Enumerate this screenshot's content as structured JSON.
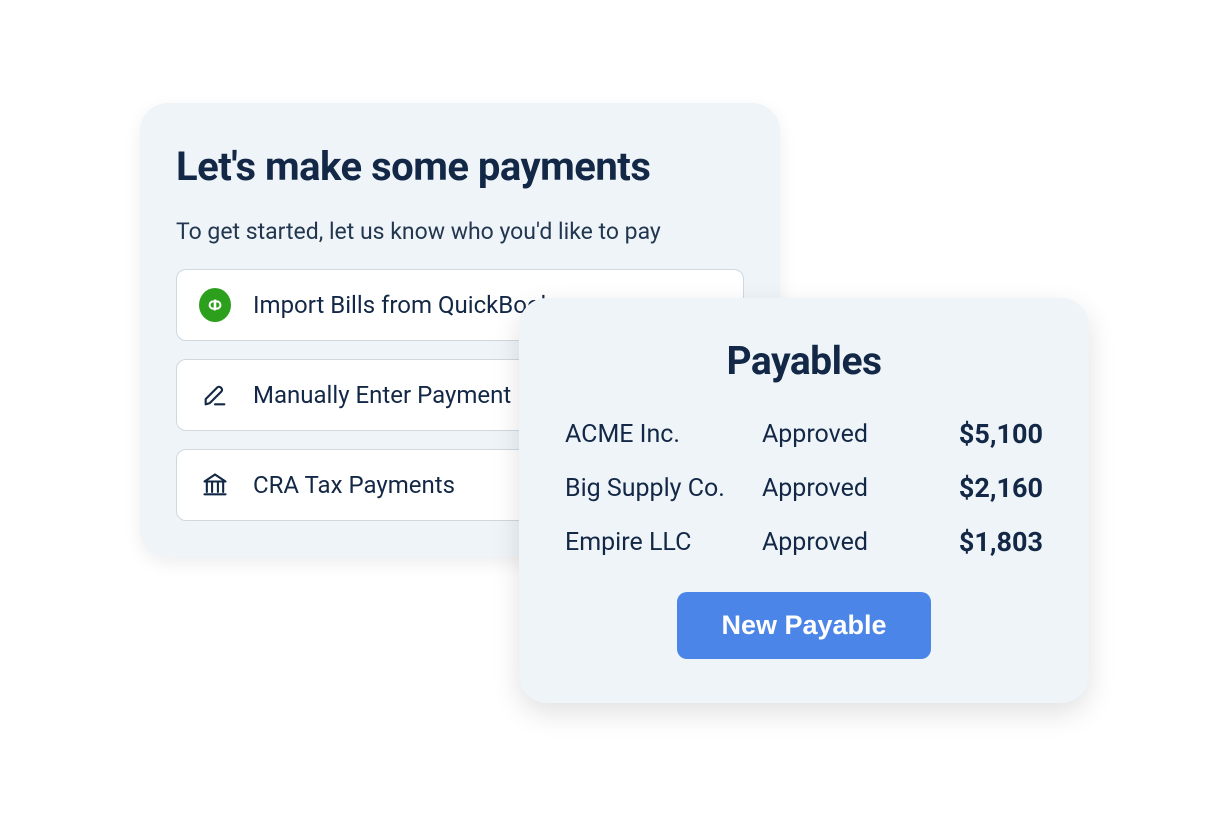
{
  "left_card": {
    "title": "Let's make some payments",
    "subtitle": "To get started, let us know who you'd like to pay",
    "options": [
      {
        "icon": "quickbooks",
        "label": "Import Bills from QuickBooks"
      },
      {
        "icon": "pencil",
        "label": "Manually Enter Payment"
      },
      {
        "icon": "bank",
        "label": "CRA Tax Payments"
      }
    ]
  },
  "right_card": {
    "title": "Payables",
    "rows": [
      {
        "company": "ACME Inc.",
        "status": "Approved",
        "amount": "$5,100"
      },
      {
        "company": "Big Supply Co.",
        "status": "Approved",
        "amount": "$2,160"
      },
      {
        "company": "Empire LLC",
        "status": "Approved",
        "amount": "$1,803"
      }
    ],
    "new_payable_label": "New Payable"
  },
  "colors": {
    "card_bg": "#eff4f8",
    "text": "#132846",
    "primary_button": "#4b85e8",
    "qb_green": "#2ca01c"
  }
}
